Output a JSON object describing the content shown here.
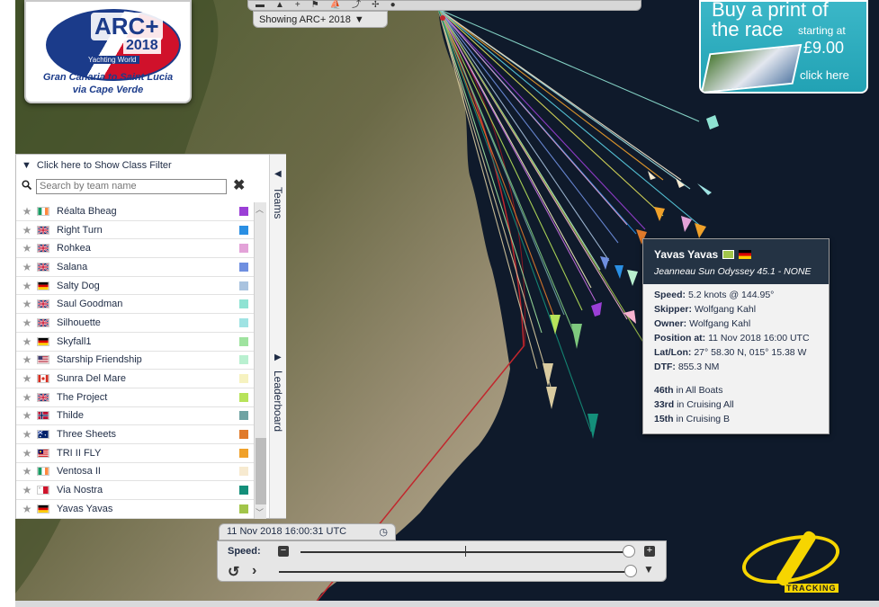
{
  "logo": {
    "brand": "ARC+",
    "year": "2018",
    "sponsor": "Yachting World",
    "subtitle_line1": "Gran Canaria to Saint Lucia",
    "subtitle_line2": "via Cape Verde"
  },
  "toolbar": {
    "icons": [
      "dash-icon",
      "cursor-icon",
      "plus-icon",
      "flag-icon",
      "boat-icon",
      "share-icon",
      "wind-icon",
      "globe-icon"
    ],
    "showing_label": "Showing ARC+ 2018"
  },
  "ad": {
    "line1": "Buy a print of",
    "line2": "the race",
    "line3": "starting at",
    "price": "£9.00",
    "cta": "click here"
  },
  "panel": {
    "filter_label": "Click here to Show Class Filter",
    "search_placeholder": "Search by team name",
    "tab_teams": "Teams",
    "tab_leaderboard": "Leaderboard",
    "teams": [
      {
        "name": "Réalta Bheag",
        "flag": "ie",
        "color": "#9b3fd6"
      },
      {
        "name": "Right Turn",
        "flag": "gb",
        "color": "#2a8fe3"
      },
      {
        "name": "Rohkea",
        "flag": "gb",
        "color": "#e3a2d8"
      },
      {
        "name": "Salana",
        "flag": "gb",
        "color": "#6f8fe0"
      },
      {
        "name": "Salty Dog",
        "flag": "de",
        "color": "#a9c3df"
      },
      {
        "name": "Saul Goodman",
        "flag": "gb",
        "color": "#8fe3d3"
      },
      {
        "name": "Silhouette",
        "flag": "gb",
        "color": "#9fe3e3"
      },
      {
        "name": "Skyfall1",
        "flag": "de",
        "color": "#9fe39f"
      },
      {
        "name": "Starship Friendship",
        "flag": "us",
        "color": "#b9f0d0"
      },
      {
        "name": "Sunra Del Mare",
        "flag": "ca",
        "color": "#f6f2c0"
      },
      {
        "name": "The Project",
        "flag": "gb",
        "color": "#b7e35a"
      },
      {
        "name": "Thilde",
        "flag": "no",
        "color": "#6fa3a3"
      },
      {
        "name": "Three Sheets",
        "flag": "au",
        "color": "#e07a2a"
      },
      {
        "name": "TRI II FLY",
        "flag": "my",
        "color": "#f0a12a"
      },
      {
        "name": "Ventosa II",
        "flag": "ie",
        "color": "#f7ead0"
      },
      {
        "name": "Via Nostra",
        "flag": "mt",
        "color": "#148f7a"
      },
      {
        "name": "Yavas Yavas",
        "flag": "de",
        "color": "#a2c54a"
      }
    ]
  },
  "popup": {
    "boat_name": "Yavas Yavas",
    "boat_type": "Jeanneau Sun Odyssey 45.1 - NONE",
    "speed_label": "Speed:",
    "speed_value": "5.2 knots @ 144.95°",
    "skipper_label": "Skipper:",
    "skipper_value": "Wolfgang Kahl",
    "owner_label": "Owner:",
    "owner_value": "Wolfgang Kahl",
    "position_label": "Position at:",
    "position_value": "11 Nov 2018 16:00 UTC",
    "latlon_label": "Lat/Lon:",
    "latlon_value": "27° 58.30 N, 015° 15.38 W",
    "dtf_label": "DTF:",
    "dtf_value": "855.3 NM",
    "rank1_pos": "46th",
    "rank1_text": "in All Boats",
    "rank2_pos": "33rd",
    "rank2_text": "in Cruising All",
    "rank3_pos": "15th",
    "rank3_text": "in Cruising B"
  },
  "timeline": {
    "timestamp": "11 Nov 2018 16:00:31 UTC",
    "speed_label": "Speed:"
  },
  "yb": {
    "tracking": "TRACKING"
  },
  "colors": {
    "ocean": "#0f1a2b",
    "panel_text": "#1f2c45",
    "ad_blue": "#22a2b4",
    "yb_yellow": "#f6d500"
  }
}
